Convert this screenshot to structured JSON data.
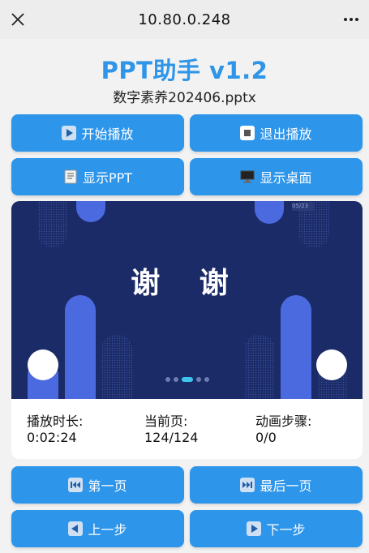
{
  "topbar": {
    "url": "10.80.0.248"
  },
  "header": {
    "title": "PPT助手 v1.2",
    "filename": "数字素养202406.pptx"
  },
  "controls": {
    "start": "开始播放",
    "exit": "退出播放",
    "show_ppt": "显示PPT",
    "show_desktop": "显示桌面"
  },
  "slide": {
    "text": "谢 谢",
    "badge": "05/23",
    "page_indicator_count": 5,
    "active_indicator": 3
  },
  "stats": {
    "play_time_label": "播放时长:",
    "play_time": "0:02:24",
    "current_page_label": "当前页:",
    "current_page": "124/124",
    "animation_label": "动画步骤:",
    "animation": "0/0"
  },
  "nav": {
    "first": "第一页",
    "last": "最后一页",
    "prev": "上一步",
    "next": "下一步"
  },
  "colors": {
    "accent": "#2d95ea",
    "title": "#2f95e8",
    "slide_bg": "#1b2b68"
  }
}
